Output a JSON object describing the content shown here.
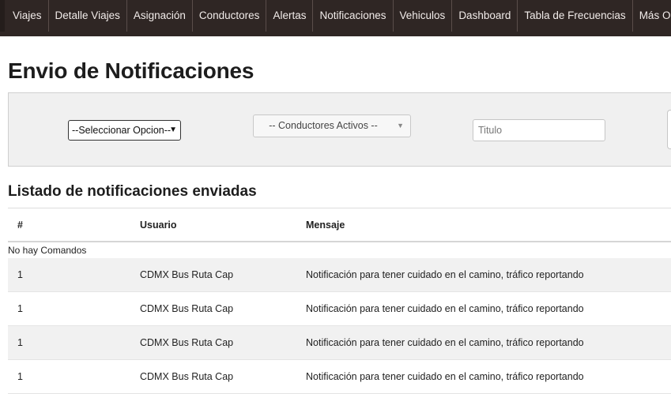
{
  "nav": {
    "items": [
      "Viajes",
      "Detalle Viajes",
      "Asignación",
      "Conductores",
      "Alertas",
      "Notificaciones",
      "Vehiculos",
      "Dashboard",
      "Tabla de Frecuencias",
      "Más Opciones"
    ]
  },
  "page": {
    "title": "Envio de Notificaciones"
  },
  "filters": {
    "option_select": "--Seleccionar Opcion--",
    "drivers_select": "-- Conductores Activos --",
    "title_placeholder": "Titulo"
  },
  "list": {
    "title": "Listado de notificaciones enviadas",
    "headers": [
      "#",
      "Usuario",
      "Mensaje"
    ],
    "empty_text": "No hay Comandos",
    "rows": [
      {
        "num": "1",
        "user": "CDMX Bus Ruta Cap",
        "message": "Notificación para tener cuidado en el camino, tráfico reportando"
      },
      {
        "num": "1",
        "user": "CDMX Bus Ruta Cap",
        "message": "Notificación para tener cuidado en el camino, tráfico reportando"
      },
      {
        "num": "1",
        "user": "CDMX Bus Ruta Cap",
        "message": "Notificación para tener cuidado en el camino, tráfico reportando"
      },
      {
        "num": "1",
        "user": "CDMX Bus Ruta Cap",
        "message": "Notificación para tener cuidado en el camino, tráfico reportando"
      }
    ]
  },
  "colors": {
    "navbar_bg": "#2f2624",
    "panel_bg": "#f0f0f0",
    "row_stripe": "#f1f1f1"
  }
}
